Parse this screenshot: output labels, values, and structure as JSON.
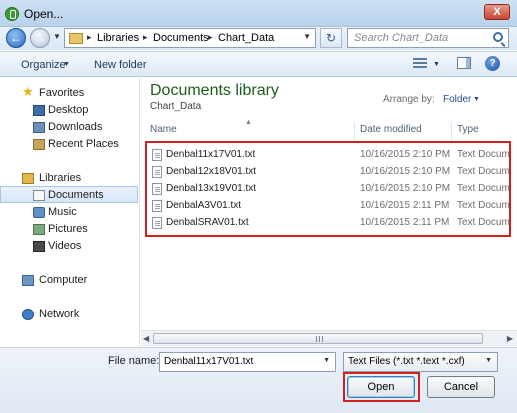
{
  "window": {
    "title": "Open...",
    "close_label": "X"
  },
  "address": {
    "crumbs": [
      "Libraries",
      "Documents",
      "Chart_Data"
    ],
    "search_placeholder": "Search Chart_Data"
  },
  "toolbar": {
    "organize_label": "Organize",
    "new_folder_label": "New folder"
  },
  "nav": {
    "favorites": "Favorites",
    "desktop": "Desktop",
    "downloads": "Downloads",
    "recent_places": "Recent Places",
    "libraries": "Libraries",
    "documents": "Documents",
    "music": "Music",
    "pictures": "Pictures",
    "videos": "Videos",
    "computer": "Computer",
    "network": "Network"
  },
  "library": {
    "title": "Documents library",
    "subtitle": "Chart_Data",
    "arrange_label": "Arrange by:",
    "arrange_value": "Folder"
  },
  "columns": {
    "name": "Name",
    "date_modified": "Date modified",
    "type": "Type"
  },
  "files": [
    {
      "name": "Denbal11x17V01.txt",
      "date": "10/16/2015 2:10 PM",
      "type": "Text Document"
    },
    {
      "name": "Denbal12x18V01.txt",
      "date": "10/16/2015 2:10 PM",
      "type": "Text Document"
    },
    {
      "name": "Denbal13x19V01.txt",
      "date": "10/16/2015 2:10 PM",
      "type": "Text Document"
    },
    {
      "name": "DenbalA3V01.txt",
      "date": "10/16/2015 2:11 PM",
      "type": "Text Document"
    },
    {
      "name": "DenbalSRAV01.txt",
      "date": "10/16/2015 2:11 PM",
      "type": "Text Document"
    }
  ],
  "footer": {
    "file_name_label": "File name:",
    "file_name_value": "Denbal11x17V01.txt",
    "file_type_value": "Text Files (*.txt *.text *.cxf)",
    "open_label": "Open",
    "cancel_label": "Cancel"
  },
  "colors": {
    "highlight": "#d21f1f",
    "library_title": "#1a5c1a"
  }
}
